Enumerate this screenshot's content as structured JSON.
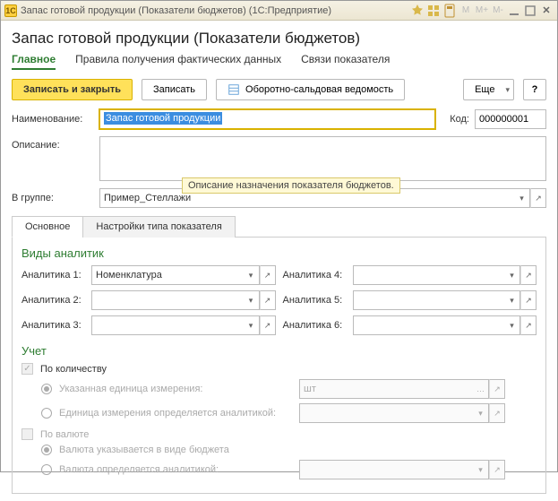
{
  "titlebar": {
    "text": "Запас готовой продукции (Показатели бюджетов)  (1С:Предприятие)",
    "app_icon_label": "1C"
  },
  "header": {
    "title": "Запас готовой продукции (Показатели бюджетов)"
  },
  "toptabs": {
    "main": "Главное",
    "rules": "Правила получения фактических данных",
    "links": "Связи показателя"
  },
  "toolbar": {
    "save_close": "Записать и закрыть",
    "save": "Записать",
    "osv": "Оборотно-сальдовая ведомость",
    "more": "Еще",
    "help": "?"
  },
  "fields": {
    "name_label": "Наименование:",
    "name_value": "Запас готовой продукции",
    "code_label": "Код:",
    "code_value": "000000001",
    "desc_label": "Описание:",
    "desc_value": "",
    "desc_tooltip": "Описание назначения показателя бюджетов.",
    "group_label": "В группе:",
    "group_value": "Пример_Стеллажи"
  },
  "innertabs": {
    "main": "Основное",
    "type": "Настройки типа показателя"
  },
  "analytics": {
    "heading": "Виды аналитик",
    "a1_label": "Аналитика 1:",
    "a1_value": "Номенклатура",
    "a2_label": "Аналитика 2:",
    "a2_value": "",
    "a3_label": "Аналитика 3:",
    "a3_value": "",
    "a4_label": "Аналитика 4:",
    "a4_value": "",
    "a5_label": "Аналитика 5:",
    "a5_value": "",
    "a6_label": "Аналитика 6:",
    "a6_value": ""
  },
  "accounting": {
    "heading": "Учет",
    "by_qty": "По количеству",
    "unit_fixed": "Указанная единица измерения:",
    "unit_fixed_value": "шт",
    "unit_analytic": "Единица измерения определяется аналитикой:",
    "unit_analytic_value": "",
    "by_currency": "По валюте",
    "cur_budget": "Валюта указывается в виде бюджета",
    "cur_analytic": "Валюта определяется аналитикой:",
    "cur_analytic_value": ""
  },
  "glyphs": {
    "dropdown": "▾",
    "open": "↗",
    "ellipsis": "…"
  },
  "titlebar_buttons": {
    "m": "M",
    "mplus": "M+",
    "mminus": "M-",
    "close": "✕"
  }
}
